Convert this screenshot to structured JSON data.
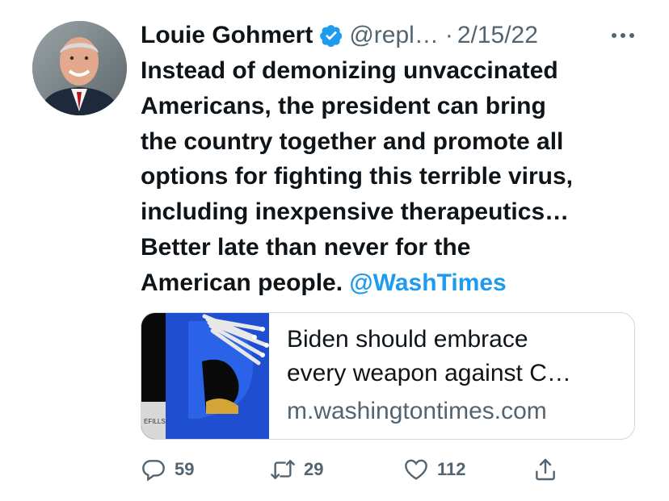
{
  "author": {
    "name": "Louie Gohmert",
    "handle": "@repl…",
    "separator": "·",
    "date": "2/15/22",
    "avatar_icon": "person-avatar",
    "verified_icon": "verified-badge-icon"
  },
  "tweet": {
    "lines": [
      "Instead of demonizing unvaccinated",
      "Americans, the president can bring",
      "the country together and promote all",
      "options for fighting this terrible virus,",
      "including inexpensive therapeutics…",
      "Better late than never for the",
      "American people."
    ],
    "mention": "@WashTimes"
  },
  "card": {
    "title_line1": "Biden should embrace",
    "title_line2": "every weapon against C…",
    "domain": "m.washingtontimes.com",
    "thumb_text": "EFILLS"
  },
  "actions": {
    "reply_count": "59",
    "retweet_count": "29",
    "like_count": "112"
  },
  "colors": {
    "text": "#0f1419",
    "secondary": "#536471",
    "link": "#1d9bf0",
    "border": "#cfd9de"
  }
}
